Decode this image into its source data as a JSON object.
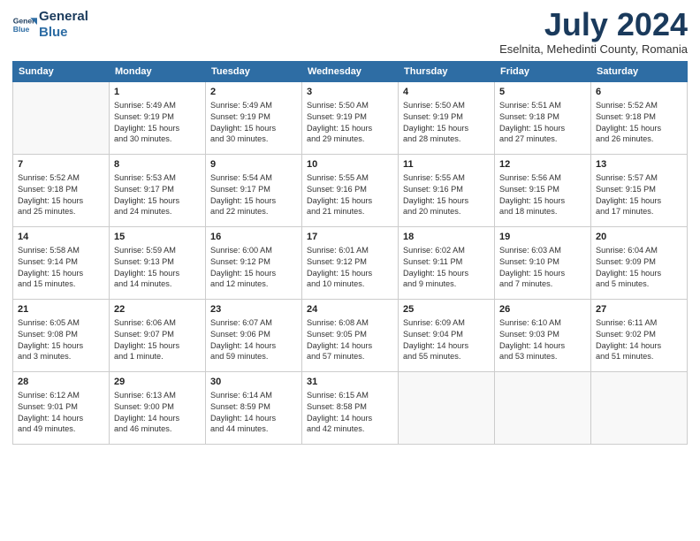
{
  "header": {
    "logo_line1": "General",
    "logo_line2": "Blue",
    "month_year": "July 2024",
    "location": "Eselnita, Mehedinti County, Romania"
  },
  "weekdays": [
    "Sunday",
    "Monday",
    "Tuesday",
    "Wednesday",
    "Thursday",
    "Friday",
    "Saturday"
  ],
  "weeks": [
    [
      {
        "day": "",
        "info": ""
      },
      {
        "day": "1",
        "info": "Sunrise: 5:49 AM\nSunset: 9:19 PM\nDaylight: 15 hours\nand 30 minutes."
      },
      {
        "day": "2",
        "info": "Sunrise: 5:49 AM\nSunset: 9:19 PM\nDaylight: 15 hours\nand 30 minutes."
      },
      {
        "day": "3",
        "info": "Sunrise: 5:50 AM\nSunset: 9:19 PM\nDaylight: 15 hours\nand 29 minutes."
      },
      {
        "day": "4",
        "info": "Sunrise: 5:50 AM\nSunset: 9:19 PM\nDaylight: 15 hours\nand 28 minutes."
      },
      {
        "day": "5",
        "info": "Sunrise: 5:51 AM\nSunset: 9:18 PM\nDaylight: 15 hours\nand 27 minutes."
      },
      {
        "day": "6",
        "info": "Sunrise: 5:52 AM\nSunset: 9:18 PM\nDaylight: 15 hours\nand 26 minutes."
      }
    ],
    [
      {
        "day": "7",
        "info": "Sunrise: 5:52 AM\nSunset: 9:18 PM\nDaylight: 15 hours\nand 25 minutes."
      },
      {
        "day": "8",
        "info": "Sunrise: 5:53 AM\nSunset: 9:17 PM\nDaylight: 15 hours\nand 24 minutes."
      },
      {
        "day": "9",
        "info": "Sunrise: 5:54 AM\nSunset: 9:17 PM\nDaylight: 15 hours\nand 22 minutes."
      },
      {
        "day": "10",
        "info": "Sunrise: 5:55 AM\nSunset: 9:16 PM\nDaylight: 15 hours\nand 21 minutes."
      },
      {
        "day": "11",
        "info": "Sunrise: 5:55 AM\nSunset: 9:16 PM\nDaylight: 15 hours\nand 20 minutes."
      },
      {
        "day": "12",
        "info": "Sunrise: 5:56 AM\nSunset: 9:15 PM\nDaylight: 15 hours\nand 18 minutes."
      },
      {
        "day": "13",
        "info": "Sunrise: 5:57 AM\nSunset: 9:15 PM\nDaylight: 15 hours\nand 17 minutes."
      }
    ],
    [
      {
        "day": "14",
        "info": "Sunrise: 5:58 AM\nSunset: 9:14 PM\nDaylight: 15 hours\nand 15 minutes."
      },
      {
        "day": "15",
        "info": "Sunrise: 5:59 AM\nSunset: 9:13 PM\nDaylight: 15 hours\nand 14 minutes."
      },
      {
        "day": "16",
        "info": "Sunrise: 6:00 AM\nSunset: 9:12 PM\nDaylight: 15 hours\nand 12 minutes."
      },
      {
        "day": "17",
        "info": "Sunrise: 6:01 AM\nSunset: 9:12 PM\nDaylight: 15 hours\nand 10 minutes."
      },
      {
        "day": "18",
        "info": "Sunrise: 6:02 AM\nSunset: 9:11 PM\nDaylight: 15 hours\nand 9 minutes."
      },
      {
        "day": "19",
        "info": "Sunrise: 6:03 AM\nSunset: 9:10 PM\nDaylight: 15 hours\nand 7 minutes."
      },
      {
        "day": "20",
        "info": "Sunrise: 6:04 AM\nSunset: 9:09 PM\nDaylight: 15 hours\nand 5 minutes."
      }
    ],
    [
      {
        "day": "21",
        "info": "Sunrise: 6:05 AM\nSunset: 9:08 PM\nDaylight: 15 hours\nand 3 minutes."
      },
      {
        "day": "22",
        "info": "Sunrise: 6:06 AM\nSunset: 9:07 PM\nDaylight: 15 hours\nand 1 minute."
      },
      {
        "day": "23",
        "info": "Sunrise: 6:07 AM\nSunset: 9:06 PM\nDaylight: 14 hours\nand 59 minutes."
      },
      {
        "day": "24",
        "info": "Sunrise: 6:08 AM\nSunset: 9:05 PM\nDaylight: 14 hours\nand 57 minutes."
      },
      {
        "day": "25",
        "info": "Sunrise: 6:09 AM\nSunset: 9:04 PM\nDaylight: 14 hours\nand 55 minutes."
      },
      {
        "day": "26",
        "info": "Sunrise: 6:10 AM\nSunset: 9:03 PM\nDaylight: 14 hours\nand 53 minutes."
      },
      {
        "day": "27",
        "info": "Sunrise: 6:11 AM\nSunset: 9:02 PM\nDaylight: 14 hours\nand 51 minutes."
      }
    ],
    [
      {
        "day": "28",
        "info": "Sunrise: 6:12 AM\nSunset: 9:01 PM\nDaylight: 14 hours\nand 49 minutes."
      },
      {
        "day": "29",
        "info": "Sunrise: 6:13 AM\nSunset: 9:00 PM\nDaylight: 14 hours\nand 46 minutes."
      },
      {
        "day": "30",
        "info": "Sunrise: 6:14 AM\nSunset: 8:59 PM\nDaylight: 14 hours\nand 44 minutes."
      },
      {
        "day": "31",
        "info": "Sunrise: 6:15 AM\nSunset: 8:58 PM\nDaylight: 14 hours\nand 42 minutes."
      },
      {
        "day": "",
        "info": ""
      },
      {
        "day": "",
        "info": ""
      },
      {
        "day": "",
        "info": ""
      }
    ]
  ]
}
